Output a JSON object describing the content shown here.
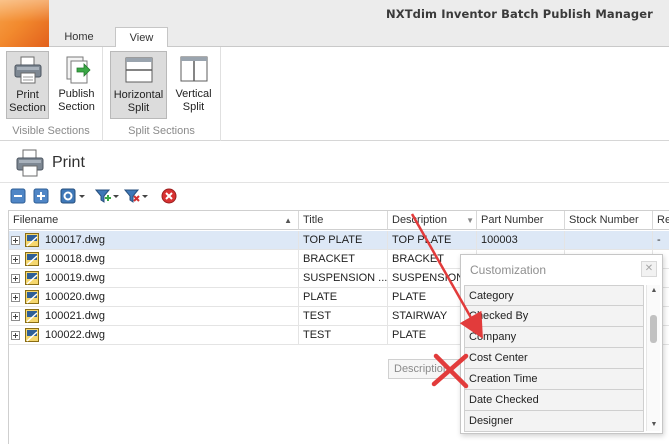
{
  "window": {
    "title": "NXTdim Inventor Batch Publish Manager"
  },
  "tabs": [
    {
      "label": "Home",
      "active": false
    },
    {
      "label": "View",
      "active": true
    }
  ],
  "ribbon": {
    "groups": [
      {
        "label": "Visible Sections",
        "buttons": [
          {
            "line1": "Print",
            "line2": "Section",
            "active": true,
            "icon": "printer-icon"
          },
          {
            "line1": "Publish",
            "line2": "Section",
            "active": false,
            "icon": "publish-icon"
          }
        ]
      },
      {
        "label": "Split Sections",
        "buttons": [
          {
            "line1": "Horizontal",
            "line2": "Split",
            "active": true,
            "icon": "horizontal-split-icon"
          },
          {
            "line1": "Vertical",
            "line2": "Split",
            "active": false,
            "icon": "vertical-split-icon"
          }
        ]
      }
    ]
  },
  "section": {
    "title": "Print"
  },
  "toolbar": {
    "icons": [
      "collapse-all-icon",
      "expand-all-icon",
      "settings-dropdown-icon",
      "add-filter-icon",
      "remove-filter-icon",
      "cancel-icon"
    ]
  },
  "grid": {
    "columns": [
      "Filename",
      "Title",
      "Description",
      "Part Number",
      "Stock Number",
      "Rev"
    ],
    "rows": [
      {
        "filename": "100017.dwg",
        "title": "TOP PLATE",
        "description": "TOP PLATE",
        "part_number": "100003",
        "stock_number": "",
        "rev": "-",
        "selected": true
      },
      {
        "filename": "100018.dwg",
        "title": "BRACKET",
        "description": "BRACKET",
        "part_number": "",
        "stock_number": "",
        "rev": "",
        "selected": false
      },
      {
        "filename": "100019.dwg",
        "title": "SUSPENSION ...",
        "description": "SUSPENSION ...",
        "part_number": "",
        "stock_number": "",
        "rev": "",
        "selected": false
      },
      {
        "filename": "100020.dwg",
        "title": "PLATE",
        "description": "PLATE",
        "part_number": "",
        "stock_number": "",
        "rev": "",
        "selected": false
      },
      {
        "filename": "100021.dwg",
        "title": "TEST",
        "description": "STAIRWAY",
        "part_number": "",
        "stock_number": "",
        "rev": "",
        "selected": false
      },
      {
        "filename": "100022.dwg",
        "title": "TEST",
        "description": "PLATE",
        "part_number": "",
        "stock_number": "",
        "rev": "",
        "selected": false
      }
    ],
    "ghost_column": "Description"
  },
  "customization": {
    "title": "Customization",
    "items": [
      "Category",
      "Checked By",
      "Company",
      "Cost Center",
      "Creation Time",
      "Date Checked",
      "Designer"
    ]
  },
  "colors": {
    "accent": "#dde8f6",
    "annotation": "#e23b3b",
    "logo": "#f28a2e"
  }
}
